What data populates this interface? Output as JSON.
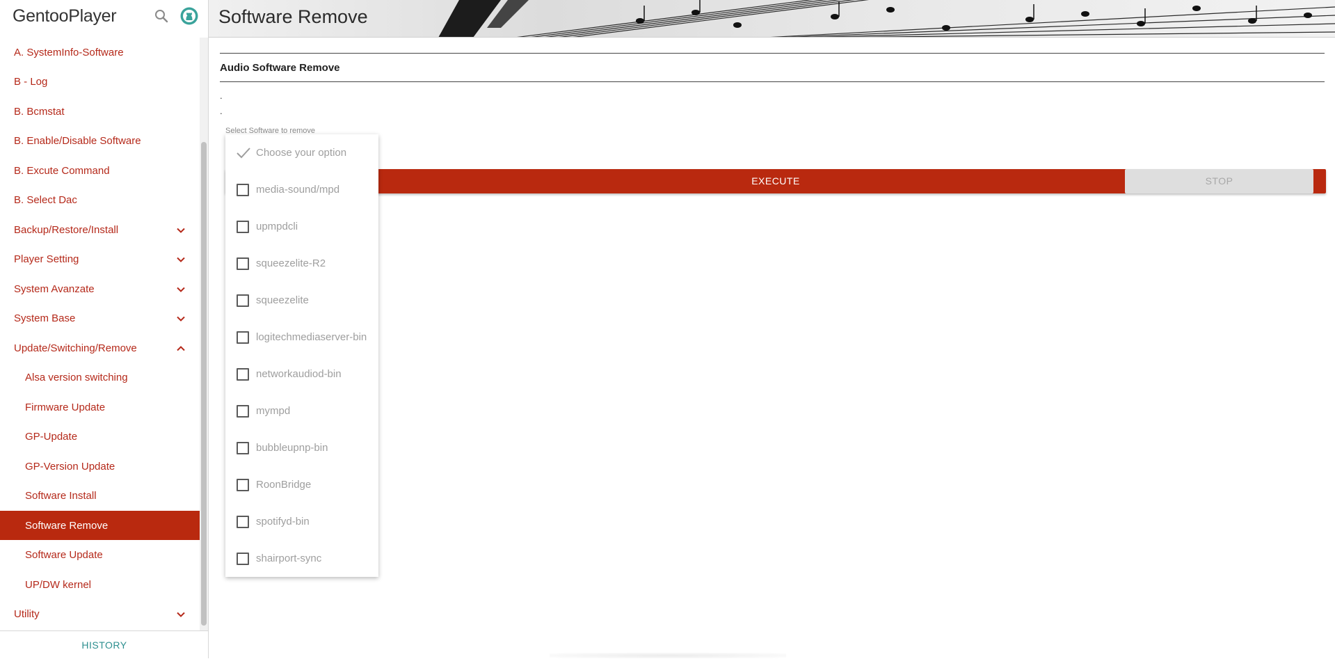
{
  "app": {
    "brand": "GentooPlayer"
  },
  "sidebar": {
    "items": [
      {
        "label": "A. SystemInfo-Software",
        "expandable": false
      },
      {
        "label": "B - Log",
        "expandable": false
      },
      {
        "label": "B. Bcmstat",
        "expandable": false
      },
      {
        "label": "B. Enable/Disable Software",
        "expandable": false
      },
      {
        "label": "B. Excute Command",
        "expandable": false
      },
      {
        "label": "B. Select Dac",
        "expandable": false
      },
      {
        "label": "Backup/Restore/Install",
        "expandable": true,
        "expanded": false
      },
      {
        "label": "Player Setting",
        "expandable": true,
        "expanded": false
      },
      {
        "label": "System Avanzate",
        "expandable": true,
        "expanded": false
      },
      {
        "label": "System Base",
        "expandable": true,
        "expanded": false
      },
      {
        "label": "Update/Switching/Remove",
        "expandable": true,
        "expanded": true
      },
      {
        "label": "Alsa version switching",
        "sub": true
      },
      {
        "label": "Firmware Update",
        "sub": true
      },
      {
        "label": "GP-Update",
        "sub": true
      },
      {
        "label": "GP-Version Update",
        "sub": true
      },
      {
        "label": "Software Install",
        "sub": true
      },
      {
        "label": "Software Remove",
        "sub": true,
        "active": true
      },
      {
        "label": "Software Update",
        "sub": true
      },
      {
        "label": "UP/DW kernel",
        "sub": true
      },
      {
        "label": "Utility",
        "expandable": true,
        "expanded": false
      }
    ],
    "history_label": "HISTORY"
  },
  "main": {
    "page_title": "Software Remove",
    "section_title": "Audio Software Remove",
    "dot1": ".",
    "dot2": ".",
    "select_label": "Select Software to remove",
    "execute_label": "EXECUTE",
    "stop_label": "STOP"
  },
  "dropdown": {
    "placeholder": "Choose your option",
    "options": [
      {
        "label": "media-sound/mpd",
        "checked": false
      },
      {
        "label": "upmpdcli",
        "checked": false
      },
      {
        "label": "squeezelite-R2",
        "checked": false
      },
      {
        "label": "squeezelite",
        "checked": false
      },
      {
        "label": "logitechmediaserver-bin",
        "checked": false
      },
      {
        "label": "networkaudiod-bin",
        "checked": false
      },
      {
        "label": "mympd",
        "checked": false
      },
      {
        "label": "bubbleupnp-bin",
        "checked": false
      },
      {
        "label": "RoonBridge",
        "checked": false
      },
      {
        "label": "spotifyd-bin",
        "checked": false
      },
      {
        "label": "shairport-sync",
        "checked": false
      }
    ]
  },
  "colors": {
    "accent": "#b9290f",
    "link": "#b5291a",
    "history": "#2d8f8f"
  }
}
